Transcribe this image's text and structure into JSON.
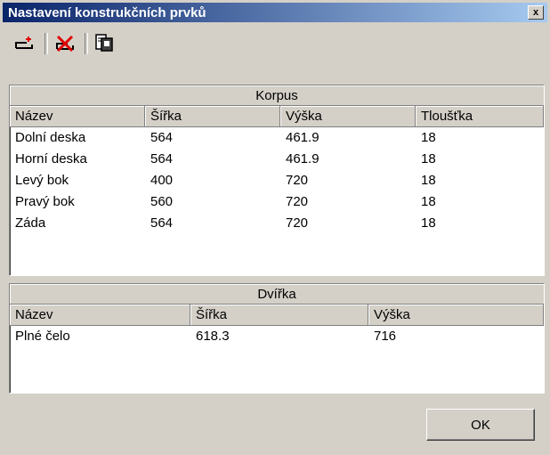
{
  "window": {
    "title": "Nastavení konstrukčních prvků",
    "close_label": "x"
  },
  "toolbar": {
    "buttons": [
      {
        "icon": "add-element-icon"
      },
      {
        "icon": "delete-element-icon"
      },
      {
        "icon": "export-icon"
      }
    ]
  },
  "korpus": {
    "group_label": "Korpus",
    "columns": [
      "Název",
      "Šířka",
      "Výška",
      "Tloušťka"
    ],
    "rows": [
      [
        "Dolní deska",
        "564",
        "461.9",
        "18"
      ],
      [
        "Horní deska",
        "564",
        "461.9",
        "18"
      ],
      [
        "Levý bok",
        "400",
        "720",
        "18"
      ],
      [
        "Pravý bok",
        "560",
        "720",
        "18"
      ],
      [
        "Záda",
        "564",
        "720",
        "18"
      ]
    ]
  },
  "dvirka": {
    "group_label": "Dvířka",
    "columns": [
      "Název",
      "Šířka",
      "Výška"
    ],
    "rows": [
      [
        "Plné čelo",
        "618.3",
        "716"
      ]
    ]
  },
  "footer": {
    "ok_label": "OK"
  },
  "colors": {
    "title_start": "#0a246a",
    "title_end": "#a6caf0",
    "face": "#d4d0c8"
  }
}
